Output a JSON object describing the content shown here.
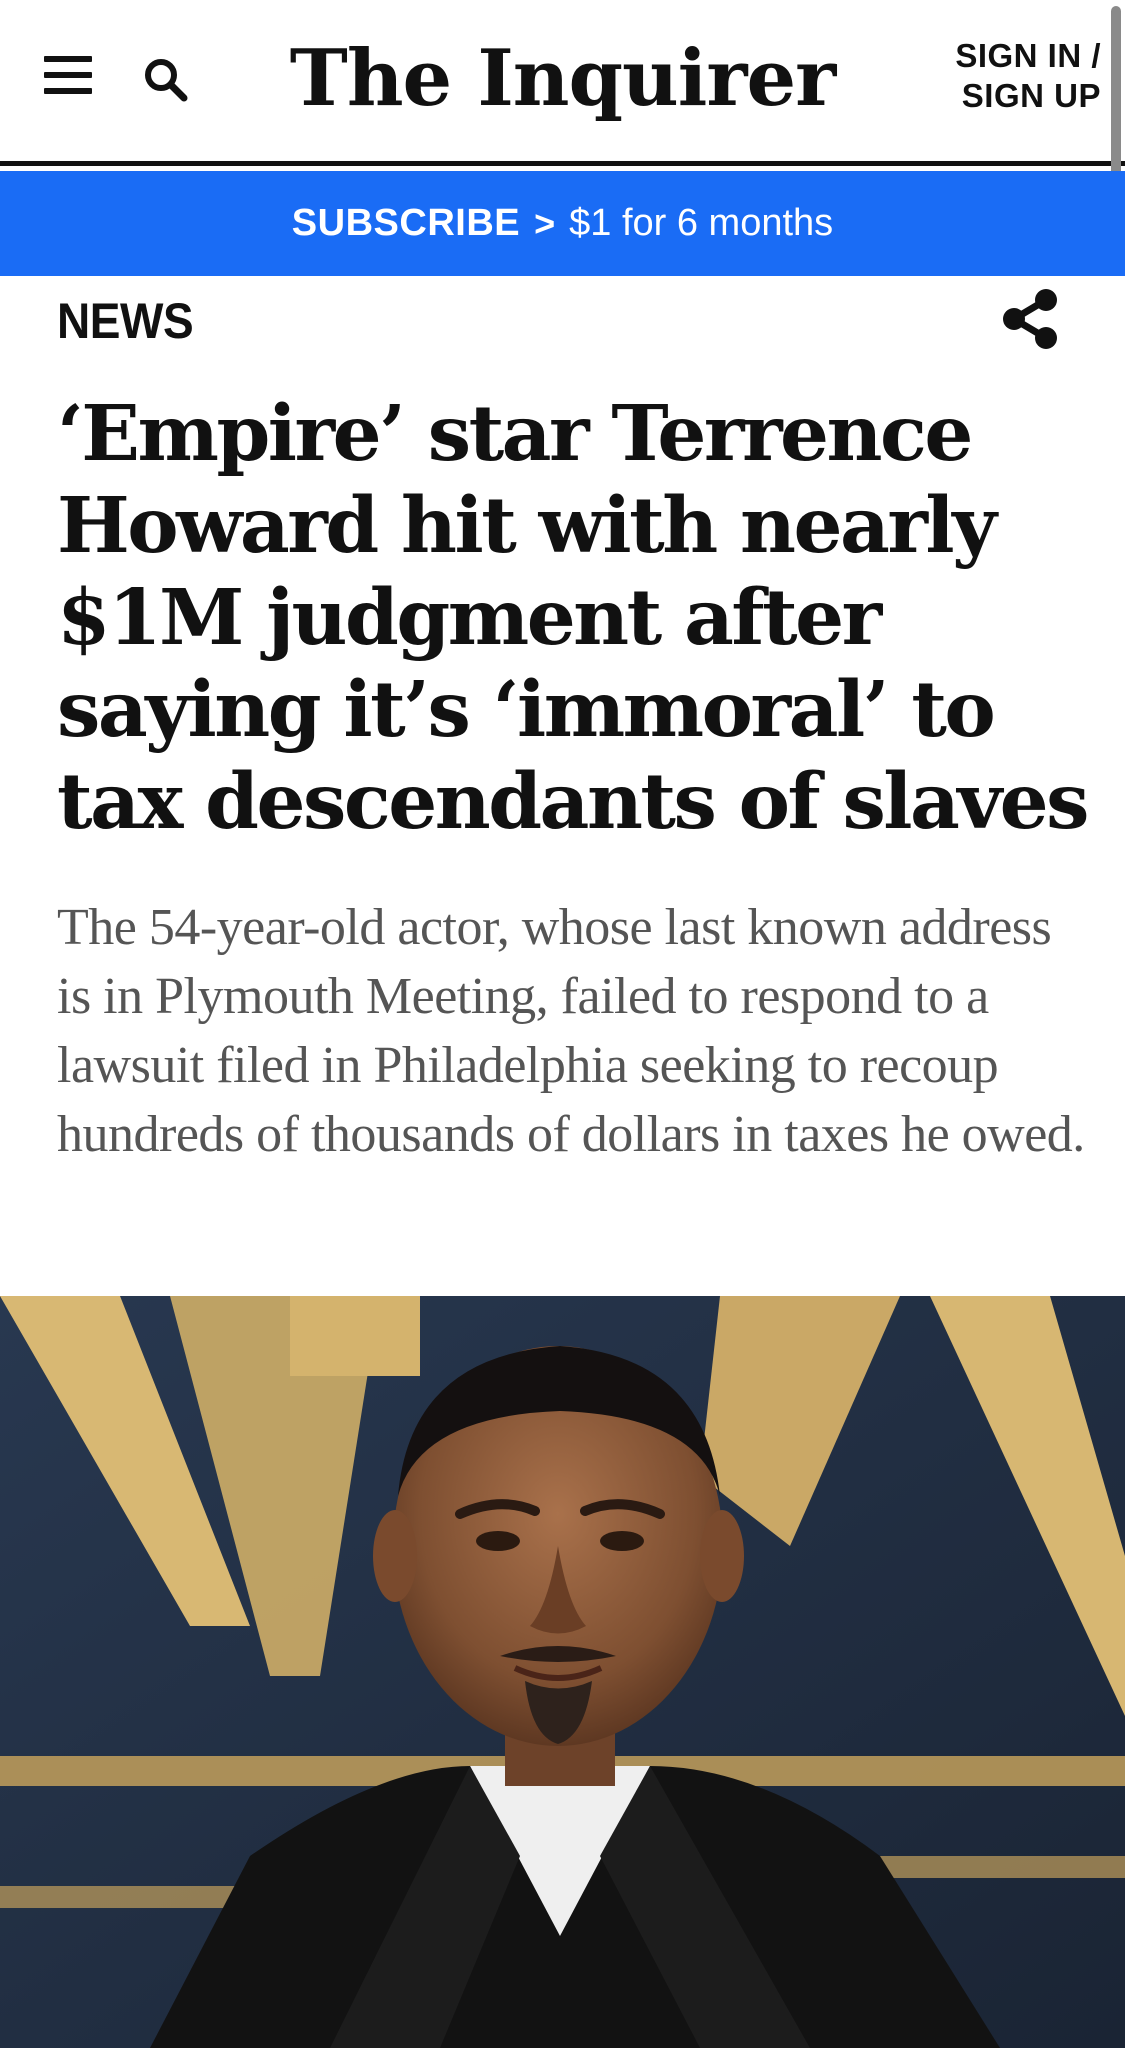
{
  "header": {
    "logo": "The Inquirer",
    "sign_in": "SIGN IN /",
    "sign_up": "SIGN UP",
    "menu_icon": "hamburger-menu-icon",
    "search_icon": "search-icon"
  },
  "subscribe_banner": {
    "label": "SUBSCRIBE",
    "chevron": ">",
    "offer": "$1 for 6 months",
    "background_color": "#1a6cf5"
  },
  "article": {
    "section": "NEWS",
    "share_icon": "share-icon",
    "headline": "‘Empire’ star Terrence Howard hit with nearly $1M judgment after saying it’s ‘immoral’ to tax descendants of slaves",
    "dek": "The 54-year-old actor, whose last known address is in Plymouth Meeting, failed to respond to a lawsuit filed in Philadelphia seeking to recoup hundreds of thousands of dollars in taxes he owed."
  }
}
